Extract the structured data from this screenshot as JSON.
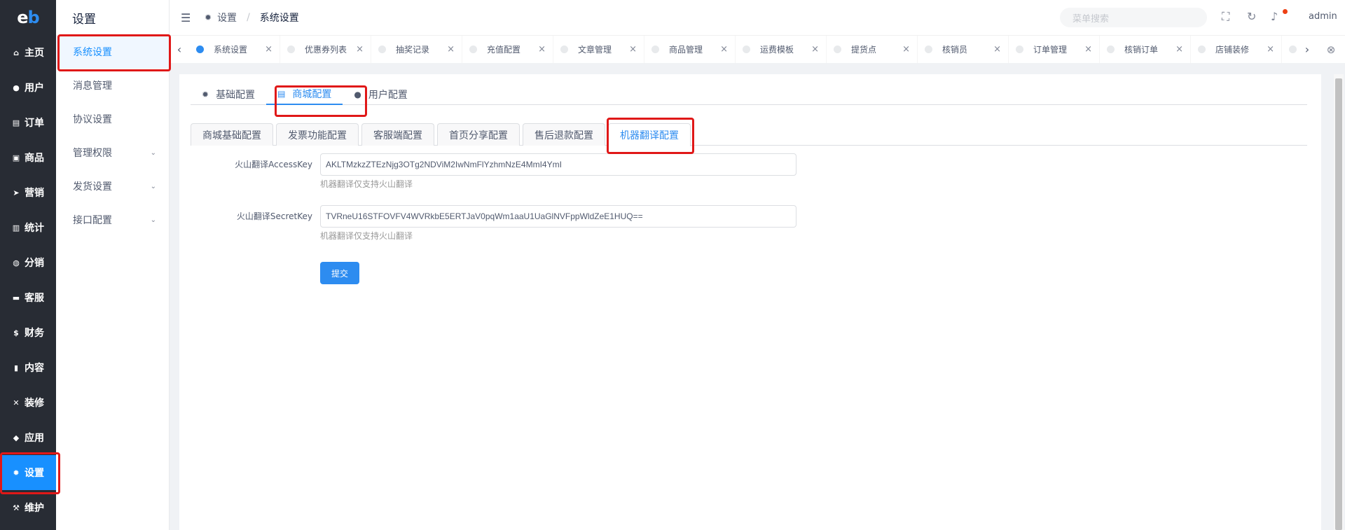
{
  "logo": {
    "left": "e",
    "right": "b"
  },
  "main_menu": [
    {
      "label": "主页",
      "icon": "home-icon",
      "glyph": "⌂"
    },
    {
      "label": "用户",
      "icon": "user-icon",
      "glyph": "●"
    },
    {
      "label": "订单",
      "icon": "cart-icon",
      "glyph": "▤"
    },
    {
      "label": "商品",
      "icon": "shop-icon",
      "glyph": "▣"
    },
    {
      "label": "营销",
      "icon": "send-icon",
      "glyph": "➤"
    },
    {
      "label": "统计",
      "icon": "chart-icon",
      "glyph": "▥"
    },
    {
      "label": "分销",
      "icon": "distribution-icon",
      "glyph": "◍"
    },
    {
      "label": "客服",
      "icon": "chat-icon",
      "glyph": "▬"
    },
    {
      "label": "财务",
      "icon": "dollar-icon",
      "glyph": "$"
    },
    {
      "label": "内容",
      "icon": "book-icon",
      "glyph": "▮"
    },
    {
      "label": "装修",
      "icon": "tools-icon",
      "glyph": "✕"
    },
    {
      "label": "应用",
      "icon": "cube-icon",
      "glyph": "◆"
    },
    {
      "label": "设置",
      "icon": "gear-icon",
      "glyph": "✹"
    },
    {
      "label": "维护",
      "icon": "hammer-icon",
      "glyph": "⚒"
    }
  ],
  "active_menu": "设置",
  "sub_menu": {
    "title": "设置",
    "items": [
      {
        "label": "系统设置",
        "expandable": false
      },
      {
        "label": "消息管理",
        "expandable": false
      },
      {
        "label": "协议设置",
        "expandable": false
      },
      {
        "label": "管理权限",
        "expandable": true
      },
      {
        "label": "发货设置",
        "expandable": true
      },
      {
        "label": "接口配置",
        "expandable": true
      }
    ]
  },
  "header": {
    "breadcrumb_root": "设置",
    "breadcrumb_sep": "/",
    "breadcrumb_current": "系统设置",
    "search_placeholder": "菜单搜索",
    "user": "admin"
  },
  "page_tabs": [
    "系统设置",
    "优惠券列表",
    "抽奖记录",
    "充值配置",
    "文章管理",
    "商品管理",
    "运费模板",
    "提货点",
    "核销员",
    "订单管理",
    "核销订单",
    "店铺装修",
    "…"
  ],
  "top_tabs": [
    {
      "label": "基础配置",
      "icon": "gear-icon",
      "glyph": "✹"
    },
    {
      "label": "商城配置",
      "icon": "cart-icon",
      "glyph": "▤"
    },
    {
      "label": "用户配置",
      "icon": "user-circle-icon",
      "glyph": "●"
    }
  ],
  "card_tabs": [
    "商城基础配置",
    "发票功能配置",
    "客服端配置",
    "首页分享配置",
    "售后退款配置",
    "机器翻译配置"
  ],
  "form": {
    "access_key": {
      "label": "火山翻译AccessKey",
      "value": "AKLTMzkzZTEzNjg3OTg2NDViM2IwNmFlYzhmNzE4MmI4YmI",
      "tip": "机器翻译仅支持火山翻译"
    },
    "secret_key": {
      "label": "火山翻译SecretKey",
      "value": "TVRneU16STFOVFV4WVRkbE5ERTJaV0pqWm1aaU1UaGlNVFppWldZeE1HUQ==",
      "tip": "机器翻译仅支持火山翻译"
    },
    "submit_label": "提交"
  },
  "colors": {
    "accent": "#2d8cf0",
    "sidebar": "#282c34",
    "annotation": "#e01818"
  }
}
